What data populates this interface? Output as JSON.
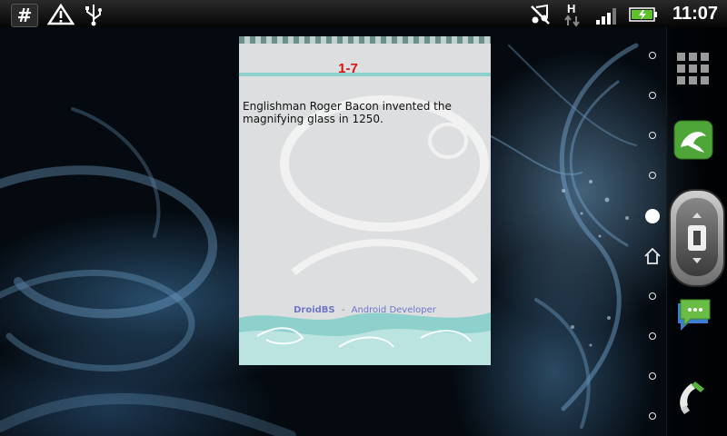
{
  "status_bar": {
    "left_icons": [
      "hash-icon",
      "warning-icon",
      "usb-icon"
    ],
    "right_icons": [
      "music-muted-icon",
      "hspa-data-icon",
      "signal-icon",
      "battery-charging-icon"
    ],
    "time": "11:07"
  },
  "card": {
    "title": "1-7",
    "fact": "Englishman Roger Bacon invented the magnifying glass in 1250.",
    "footer_brand": "DroidBS",
    "footer_separator": "-",
    "footer_role": "Android Developer"
  },
  "dock": {
    "items": [
      "app-drawer-icon",
      "dolphin-browser-icon",
      "navigation-trackball-icon",
      "messaging-icon",
      "phone-icon"
    ]
  },
  "home_indicator": {
    "page_count": 9,
    "active_page": 5
  },
  "colors": {
    "title_red": "#e01010",
    "footer_blue": "#6f76c9",
    "card_bg": "#dcdedf",
    "accent_teal": "#8ed0cc"
  }
}
